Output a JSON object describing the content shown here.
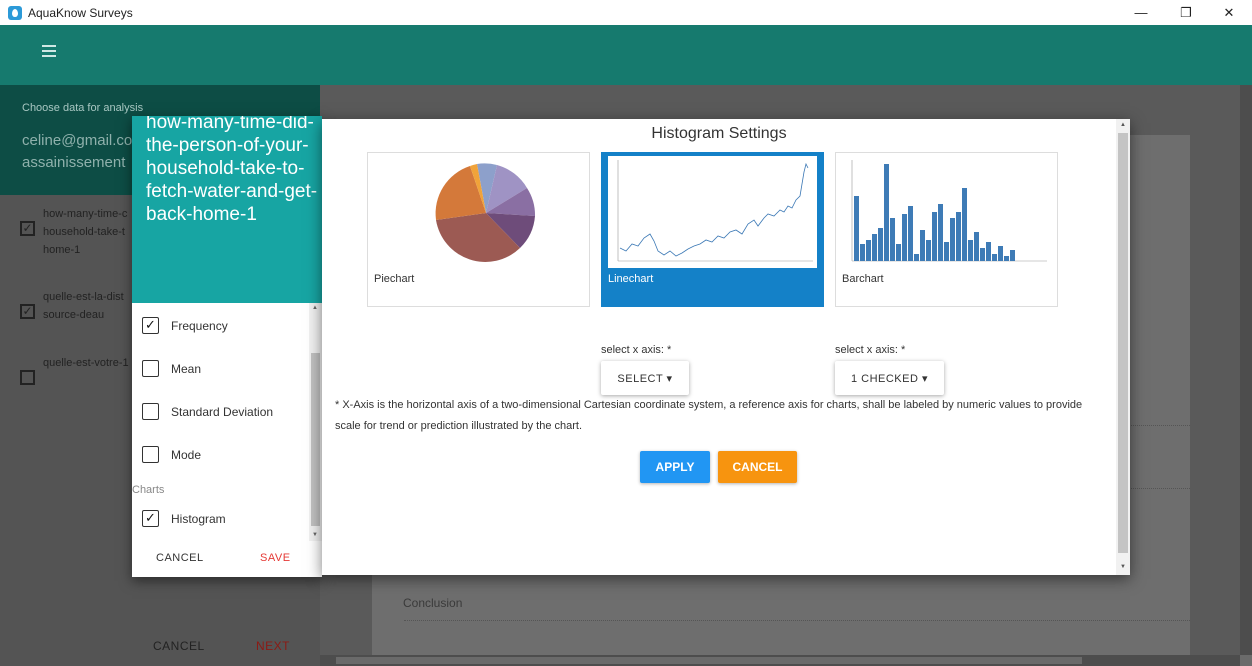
{
  "window": {
    "title": "AquaKnow Surveys",
    "minimize": "—",
    "restore": "❐",
    "close": "✕"
  },
  "sidebar": {
    "choose_label": "Choose data for analysis",
    "email": "celine@gmail.co",
    "survey": "assainissement",
    "items": [
      {
        "label": "how-many-time-c household-take-t home-1",
        "check": "✓"
      },
      {
        "label": "quelle-est-la-dist source-deau",
        "check": "✓"
      },
      {
        "label": "quelle-est-votre-1",
        "check": ""
      }
    ],
    "cancel": "CANCEL",
    "next": "NEXT"
  },
  "background": {
    "conclusion": "Conclusion"
  },
  "stats_dialog": {
    "question": "how-many-time-did-the-person-of-your-household-take-to-fetch-water-and-get-back-home-1",
    "options": [
      {
        "label": "Frequency",
        "check": "✓"
      },
      {
        "label": "Mean",
        "check": ""
      },
      {
        "label": "Standard Deviation",
        "check": ""
      },
      {
        "label": "Mode",
        "check": ""
      }
    ],
    "charts_section": "Charts",
    "chart_options": [
      {
        "label": "Histogram",
        "check": "✓"
      }
    ],
    "cancel": "CANCEL",
    "save": "SAVE"
  },
  "hist_dialog": {
    "title": "Histogram Settings",
    "chart_types": [
      {
        "label": "Piechart",
        "selected": false
      },
      {
        "label": "Linechart",
        "selected": true
      },
      {
        "label": "Barchart",
        "selected": false
      }
    ],
    "x_axis_label_1": "select x axis: *",
    "x_axis_select_1": "SELECT ▾",
    "x_axis_label_2": "select x axis: *",
    "x_axis_select_2": "1 CHECKED ▾",
    "note": "* X-Axis is the horizontal axis of a two-dimensional Cartesian coordinate system, a reference axis for charts, shall be labeled by numeric values to provide scale for trend or prediction illustrated by the chart.",
    "apply": "APPLY",
    "cancel": "CANCEL"
  },
  "colors": {
    "teal_header": "#167a6e",
    "dialog_teal": "#17a5a3",
    "selected_blue": "#1481c8",
    "apply_blue": "#2196f3",
    "cancel_orange": "#f7940f",
    "save_red": "#e53935"
  }
}
